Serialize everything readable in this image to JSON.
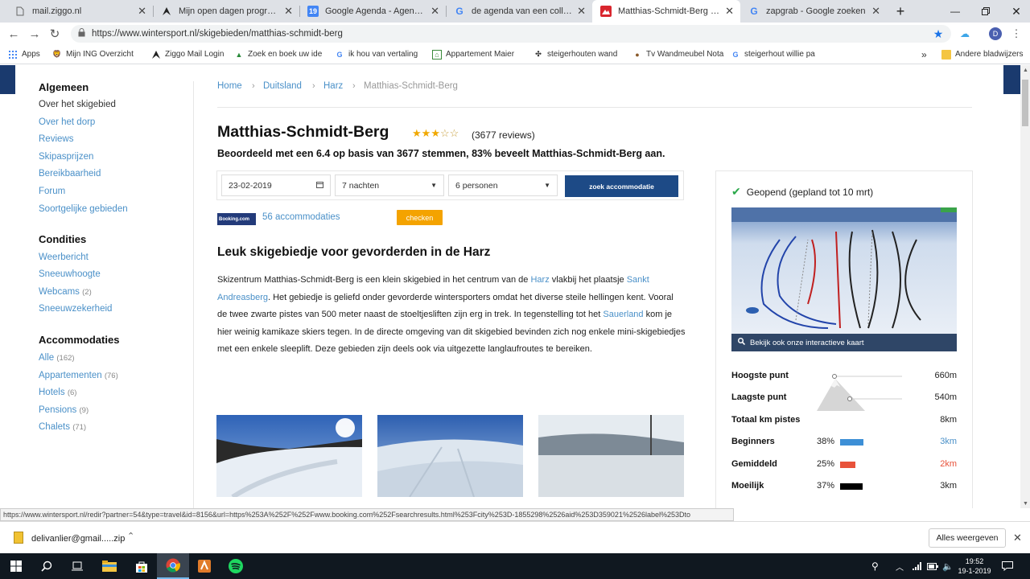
{
  "tabs": [
    {
      "title": "mail.ziggo.nl",
      "icon": "page-icon"
    },
    {
      "title": "Mijn open dagen programma",
      "icon": "arrow-icon"
    },
    {
      "title": "Google Agenda - Agenda-instellingen",
      "icon": "calendar-icon",
      "badge": "19"
    },
    {
      "title": "de agenda van een collega toevoegen",
      "icon": "google-icon"
    },
    {
      "title": "Matthias-Schmidt-Berg - skigebied",
      "icon": "wintersport-icon"
    },
    {
      "title": "zapgrab - Google zoeken",
      "icon": "google-icon"
    }
  ],
  "url": "https://www.wintersport.nl/skigebieden/matthias-schmidt-berg",
  "profile_initial": "D",
  "bookmarks": [
    "Apps",
    "Mijn ING Overzicht",
    "Ziggo Mail Login",
    "Zoek en boek uw ide",
    "ik hou van vertaling",
    "Appartement Maier",
    "steigerhouten wand",
    "Tv Wandmeubel Nota",
    "steigerhout willie pa",
    "»",
    "Andere bladwijzers"
  ],
  "sidebar": {
    "sections": [
      {
        "title": "Algemeen",
        "items": [
          {
            "label": "Over het skigebied",
            "count": ""
          },
          {
            "label": "Over het dorp",
            "count": ""
          },
          {
            "label": "Reviews",
            "count": ""
          },
          {
            "label": "Skipasprijzen",
            "count": ""
          },
          {
            "label": "Bereikbaarheid",
            "count": ""
          },
          {
            "label": "Forum",
            "count": ""
          },
          {
            "label": "Soortgelijke gebieden",
            "count": ""
          }
        ]
      },
      {
        "title": "Condities",
        "items": [
          {
            "label": "Weerbericht",
            "count": ""
          },
          {
            "label": "Sneeuwhoogte",
            "count": ""
          },
          {
            "label": "Webcams",
            "count": "(2)"
          },
          {
            "label": "Sneeuwzekerheid",
            "count": ""
          }
        ]
      },
      {
        "title": "Accommodaties",
        "items": [
          {
            "label": "Alle",
            "count": "(162)"
          },
          {
            "label": "Appartementen",
            "count": "(76)"
          },
          {
            "label": "Hotels",
            "count": "(6)"
          },
          {
            "label": "Pensions",
            "count": "(9)"
          },
          {
            "label": "Chalets",
            "count": "(71)"
          }
        ]
      }
    ]
  },
  "breadcrumb": [
    "Home",
    "Duitsland",
    "Harz",
    "Matthias-Schmidt-Berg"
  ],
  "title": "Matthias-Schmidt-Berg",
  "rating": {
    "stars": 3,
    "max": 5,
    "reviews": "(3677 reviews)"
  },
  "summary": "Beoordeeld met een 6.4 op basis van 3677 stemmen, 83% beveelt Matthias-Schmidt-Berg aan.",
  "search": {
    "date": "23-02-2019",
    "nights": "7 nachten",
    "persons": "6 personen",
    "button": "zoek accommodatie"
  },
  "booking": {
    "logo": "Booking.com",
    "link": "56 accommodaties",
    "check_button": "checken"
  },
  "article": {
    "heading": "Leuk skigebiedje voor gevorderden in de Harz",
    "p1": "Skizentrum Matthias-Schmidt-Berg is een klein skigebied in het centrum van de ",
    "link1": "Harz",
    "p2": " vlakbij het plaatsje ",
    "link2": "Sankt Andreasberg",
    "p3": ". Het gebiedje is geliefd onder gevorderde wintersporters omdat het diverse steile hellingen kent. Vooral de twee zwarte pistes van 500 meter naast de stoeltjesliften zijn erg in trek. In tegenstelling tot het ",
    "link3": "Sauerland",
    "p4": " kom je hier weinig kamikaze skiers tegen. In de directe omgeving van dit skigebied bevinden zich nog enkele mini-skigebiedjes met een enkele sleeplift. Deze gebieden zijn deels ook via uitgezette langlaufroutes te bereiken."
  },
  "info": {
    "status": "Geopend (gepland tot 10 mrt)",
    "map_link": "Bekijk ook onze interactieve kaart",
    "highest_label": "Hoogste punt",
    "highest_value": "660m",
    "lowest_label": "Laagste punt",
    "lowest_value": "540m",
    "total_label": "Totaal km pistes",
    "total_value": "8km",
    "slopes": [
      {
        "label": "Beginners",
        "pct": "38%",
        "fraction": 0.38,
        "km": "3km",
        "color": "#3d8fd6"
      },
      {
        "label": "Gemiddeld",
        "pct": "25%",
        "fraction": 0.25,
        "km": "2km",
        "color": "#e8523a"
      },
      {
        "label": "Moeilijk",
        "pct": "37%",
        "fraction": 0.37,
        "km": "3km",
        "color": "#000000"
      }
    ]
  },
  "status_url": "https://www.wintersport.nl/redir?partner=54&type=travel&id=8156&url=https%253A%252F%252Fwww.booking.com%252Fsearchresults.html%253Fcity%253D-1855298%2526aid%253D359021%2526label%253Dto",
  "download": {
    "file": "delivanlier@gmail.....zip",
    "show_all": "Alles weergeven"
  },
  "clock": {
    "time": "19:52",
    "date": "19-1-2019"
  }
}
